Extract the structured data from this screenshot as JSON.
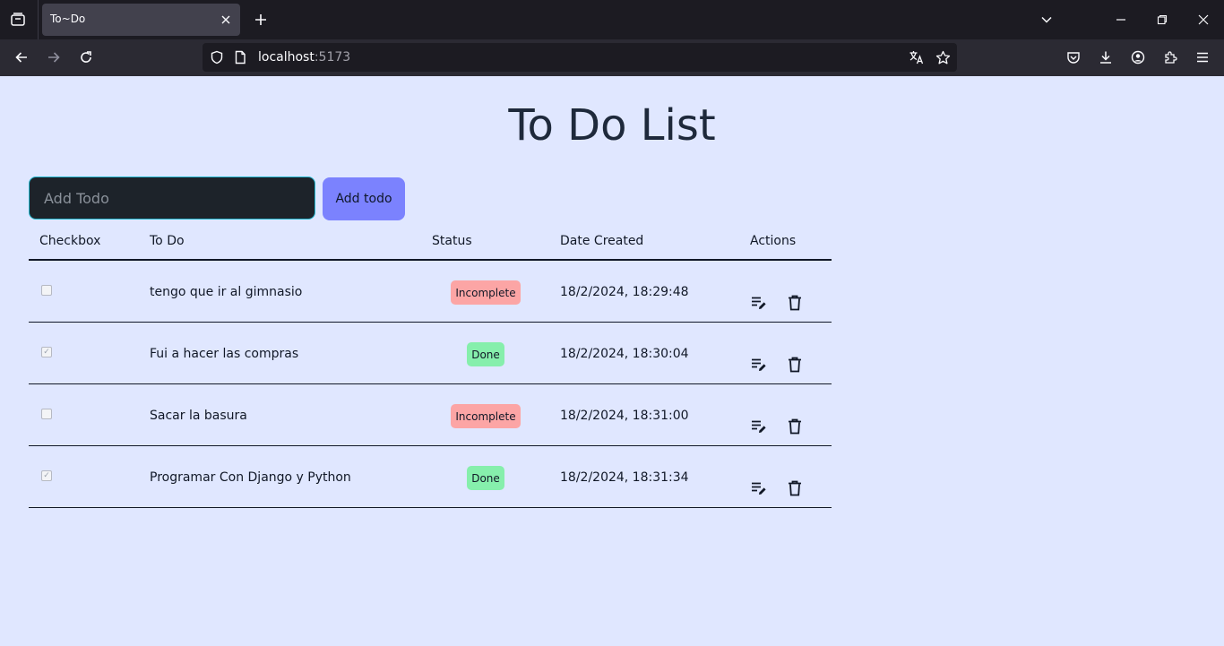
{
  "browser": {
    "tab_title": "To~Do",
    "url_host": "localhost",
    "url_port": ":5173"
  },
  "page": {
    "title": "To Do List",
    "input_placeholder": "Add Todo",
    "input_value": "",
    "add_button_label": "Add todo"
  },
  "table": {
    "headers": {
      "checkbox": "Checkbox",
      "todo": "To Do",
      "status": "Status",
      "date_created": "Date Created",
      "actions": "Actions"
    },
    "rows": [
      {
        "checked": false,
        "todo": "tengo que ir al gimnasio",
        "status": "Incomplete",
        "date": "18/2/2024, 18:29:48"
      },
      {
        "checked": true,
        "todo": "Fui a hacer las compras",
        "status": "Done",
        "date": "18/2/2024, 18:30:04"
      },
      {
        "checked": false,
        "todo": "Sacar la basura",
        "status": "Incomplete",
        "date": "18/2/2024, 18:31:00"
      },
      {
        "checked": true,
        "todo": "Programar Con Django y Python",
        "status": "Done",
        "date": "18/2/2024, 18:31:34"
      }
    ]
  },
  "colors": {
    "page_bg": "#e0e7ff",
    "incomplete_badge": "#fca5a5",
    "done_badge": "#86efac",
    "add_button": "#7b82fe",
    "input_bg": "#1d232a"
  },
  "icons": {
    "edit": "playlist-edit-icon",
    "delete": "trash-icon"
  }
}
